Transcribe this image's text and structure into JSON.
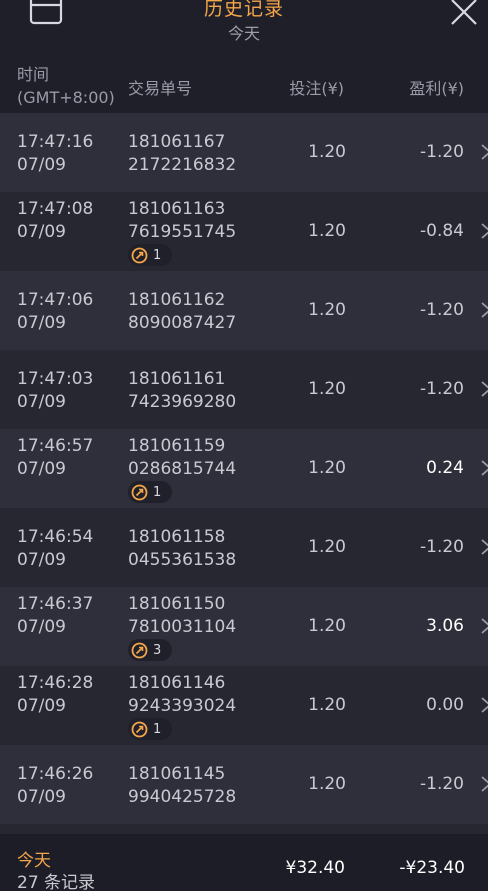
{
  "header": {
    "title": "历史记录",
    "subtitle": "今天"
  },
  "columns": {
    "time_line1": "时间",
    "time_line2": "(GMT+8:00)",
    "order": "交易单号",
    "bet": "投注(¥)",
    "profit": "盈利(¥)"
  },
  "rows": [
    {
      "time": "17:47:16",
      "date": "07/09",
      "order1": "181061167",
      "order2": "2172216832",
      "badge": null,
      "bet": "1.20",
      "profit": "-1.20",
      "win": false
    },
    {
      "time": "17:47:08",
      "date": "07/09",
      "order1": "181061163",
      "order2": "7619551745",
      "badge": "1",
      "bet": "1.20",
      "profit": "-0.84",
      "win": false
    },
    {
      "time": "17:47:06",
      "date": "07/09",
      "order1": "181061162",
      "order2": "8090087427",
      "badge": null,
      "bet": "1.20",
      "profit": "-1.20",
      "win": false
    },
    {
      "time": "17:47:03",
      "date": "07/09",
      "order1": "181061161",
      "order2": "7423969280",
      "badge": null,
      "bet": "1.20",
      "profit": "-1.20",
      "win": false
    },
    {
      "time": "17:46:57",
      "date": "07/09",
      "order1": "181061159",
      "order2": "0286815744",
      "badge": "1",
      "bet": "1.20",
      "profit": "0.24",
      "win": true
    },
    {
      "time": "17:46:54",
      "date": "07/09",
      "order1": "181061158",
      "order2": "0455361538",
      "badge": null,
      "bet": "1.20",
      "profit": "-1.20",
      "win": false
    },
    {
      "time": "17:46:37",
      "date": "07/09",
      "order1": "181061150",
      "order2": "7810031104",
      "badge": "3",
      "bet": "1.20",
      "profit": "3.06",
      "win": true
    },
    {
      "time": "17:46:28",
      "date": "07/09",
      "order1": "181061146",
      "order2": "9243393024",
      "badge": "1",
      "bet": "1.20",
      "profit": "0.00",
      "win": false
    },
    {
      "time": "17:46:26",
      "date": "07/09",
      "order1": "181061145",
      "order2": "9940425728",
      "badge": null,
      "bet": "1.20",
      "profit": "-1.20",
      "win": false
    }
  ],
  "footer": {
    "today_label": "今天",
    "count_label": "27 条记录",
    "total_bet": "¥32.40",
    "total_profit": "-¥23.40"
  },
  "colors": {
    "accent": "#f4a64a",
    "background": "#2a2a36",
    "header_bg": "#1f1f29"
  },
  "icons": {
    "calendar": "calendar-icon",
    "close": "close-icon",
    "badge": "multiplier-badge-icon",
    "chevron": "chevron-right-icon"
  }
}
